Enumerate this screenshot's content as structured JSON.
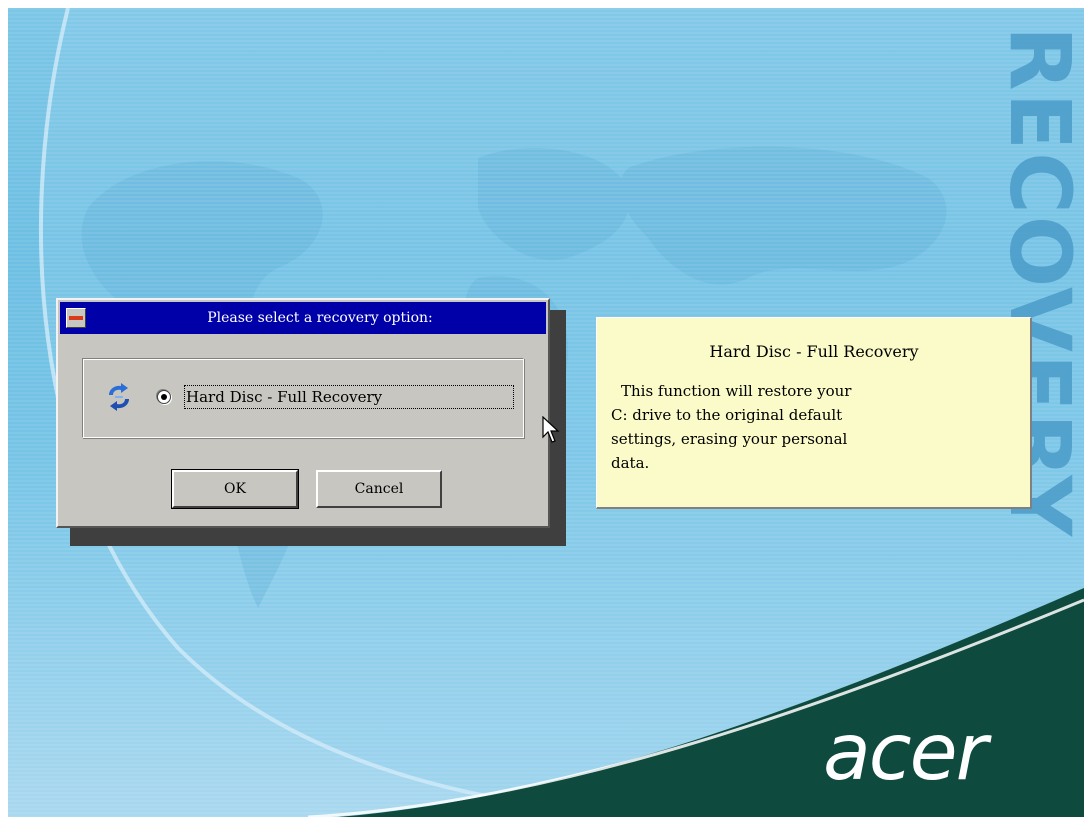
{
  "screen": {
    "side_word": "RECOVERY",
    "logo_text": "acer",
    "colors": {
      "sky": "#7cc6e6",
      "accent_word": "#4a9cc9",
      "corner_green": "#0e4a3e",
      "titlebar": "#0000a8",
      "panel_bg": "#fbfbc9",
      "dialog_bg": "#c8c6c0"
    }
  },
  "dialog": {
    "title": "Please select a recovery option:",
    "sys_menu_icon": "system-menu-icon",
    "option_icon": "recovery-arrows-icon",
    "option": {
      "label": "Hard Disc - Full Recovery",
      "selected": true
    },
    "ok_label": "OK",
    "cancel_label": "Cancel"
  },
  "info_panel": {
    "title": "Hard Disc - Full Recovery",
    "lines": [
      "This function will restore your",
      "C: drive to the original default",
      "settings, erasing your personal",
      "data."
    ]
  },
  "cursor_icon": "mouse-pointer-icon"
}
